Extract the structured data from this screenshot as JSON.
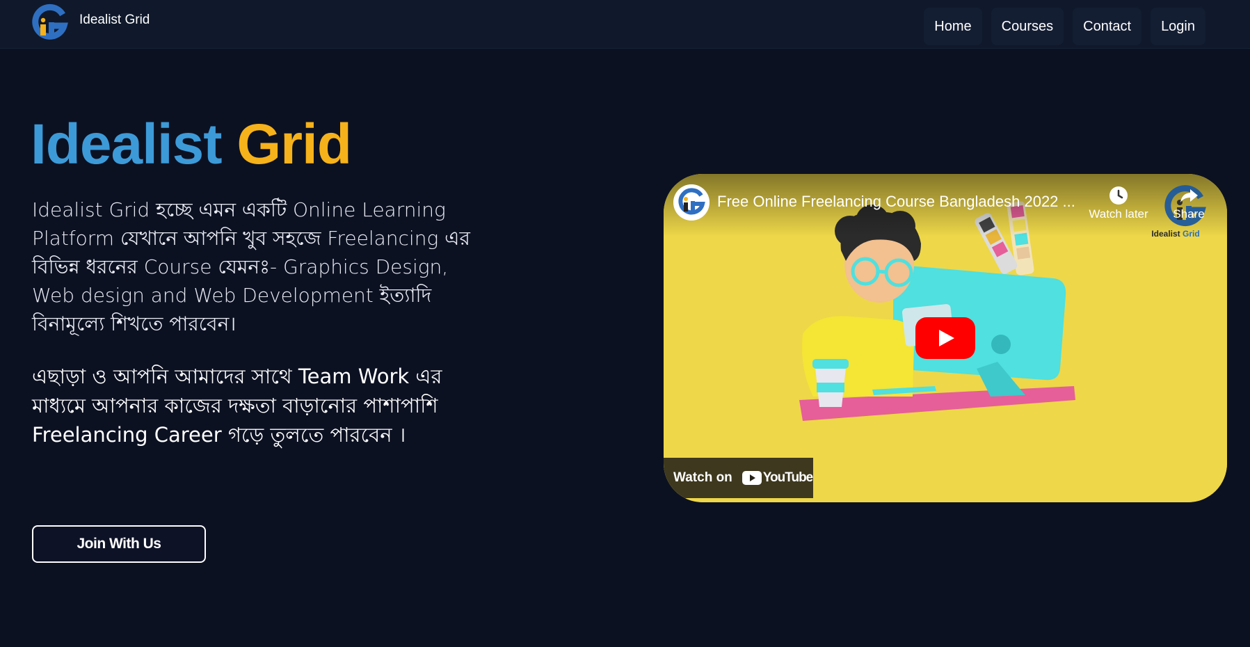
{
  "colors": {
    "background": "#0c1122",
    "navbar": "#0f192b",
    "title_primary": "#3d9ad8",
    "title_accent": "#f6b21a",
    "video_background": "#eed749",
    "youtube_red": "#ff0000"
  },
  "header": {
    "brand_name": "Idealist Grid",
    "nav": [
      {
        "label": "Home"
      },
      {
        "label": "Courses"
      },
      {
        "label": "Contact"
      },
      {
        "label": "Login"
      }
    ]
  },
  "hero": {
    "title_part1": "Idealist",
    "title_part2": "Grid",
    "description": "Idealist Grid হচ্ছে এমন একটি Online Learning Platform যেখানে আপনি খুব সহজে Freelancing এর বিভিন্ন ধরনের Course যেমনঃ- Graphics Design, Web design and Web Development ইত্যাদি বিনামূল্যে শিখতে পারবেন।",
    "description2": "এছাড়া ও আপনি আমাদের সাথে Team Work এর মাধ্যমে আপনার কাজের দক্ষতা বাড়ানোর পাশাপাশি Freelancing Career গড়ে তুলতে পারবেন ।",
    "join_label": "Join With Us"
  },
  "video": {
    "title": "Free Online Freelancing Course Bangladesh 2022 ...",
    "watch_later_label": "Watch later",
    "share_label": "Share",
    "watermark_part1": "Idealist",
    "watermark_part2": "Grid",
    "watch_on_label": "Watch on",
    "youtube_wordmark": "YouTube",
    "icons": [
      "clock-icon",
      "share-arrow-icon",
      "play-icon",
      "youtube-logo-icon"
    ]
  }
}
